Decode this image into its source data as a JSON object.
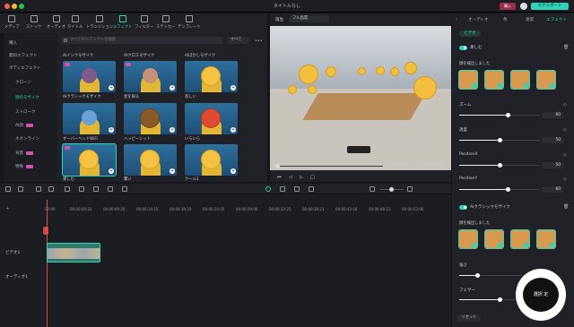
{
  "window": {
    "title": "タイトルなし",
    "buy": "購入",
    "export": "エクスポート"
  },
  "toolbar": {
    "items": [
      "メディア",
      "ストック",
      "オーディオ",
      "タイトル",
      "トランジション",
      "エフェクト",
      "フィルター",
      "ステッカー",
      "テンプレート"
    ]
  },
  "sidebar": {
    "items": [
      "購入",
      "無料エフェクト",
      "ボディエフェクト",
      "クローン",
      "顔のモザイク",
      "ストローク",
      "AI顔",
      "ネオンライン",
      "背景",
      "特殊"
    ]
  },
  "browser": {
    "search_placeholder": "すべてのエフェクトを検索",
    "filter": "すべて",
    "cards": [
      [
        "AIインクモザイク",
        "AIクロスモザイク",
        "AIぼかしモザイク"
      ],
      [
        "AIクラシックモザイク",
        "星を探る",
        "悲しい"
      ],
      [
        "オーバーヘッドWiFi",
        "ハッピーシット",
        "いらいら"
      ],
      [
        "楽しむ",
        "驚い",
        "クール1"
      ]
    ]
  },
  "preview": {
    "play_label": "再生",
    "quality": "フル品質",
    "time_current": "00:00:00:00",
    "time_total": "00:00:07:19"
  },
  "timeline": {
    "ticks": [
      "00:00",
      "00:00:04:25",
      "00:00:09:20",
      "00:00:14:15",
      "00:00:19:10",
      "00:00:24:05",
      "00:00:29:00",
      "00:00:33:25",
      "00:00:38:21",
      "00:00:43:16",
      "00:00:48:11",
      "00:00:53:06"
    ],
    "video_track": "ビデオ1",
    "audio_track": "オーディオ1"
  },
  "inspector": {
    "tabs": [
      "オーディオ",
      "色",
      "速度",
      "エフェクト"
    ],
    "section_tab": "ビデオ",
    "effect1": {
      "name": "楽しむ",
      "detected": "顔を検出しました",
      "params": [
        {
          "label": "ズーム",
          "value": 60
        },
        {
          "label": "透度",
          "value": 50
        },
        {
          "label": "PositionX",
          "value": 50
        },
        {
          "label": "PositionY",
          "value": 60
        }
      ]
    },
    "effect2": {
      "name": "AIクラシックモザイク",
      "detected": "顔を検出しました",
      "params": [
        {
          "label": "強さ"
        },
        {
          "label": "フェザー"
        }
      ]
    },
    "reset": "リセット"
  },
  "watermark": {
    "text": "選択 定"
  },
  "colors": {
    "accent": "#2fd3b6",
    "buy": "#9c2d4a"
  }
}
